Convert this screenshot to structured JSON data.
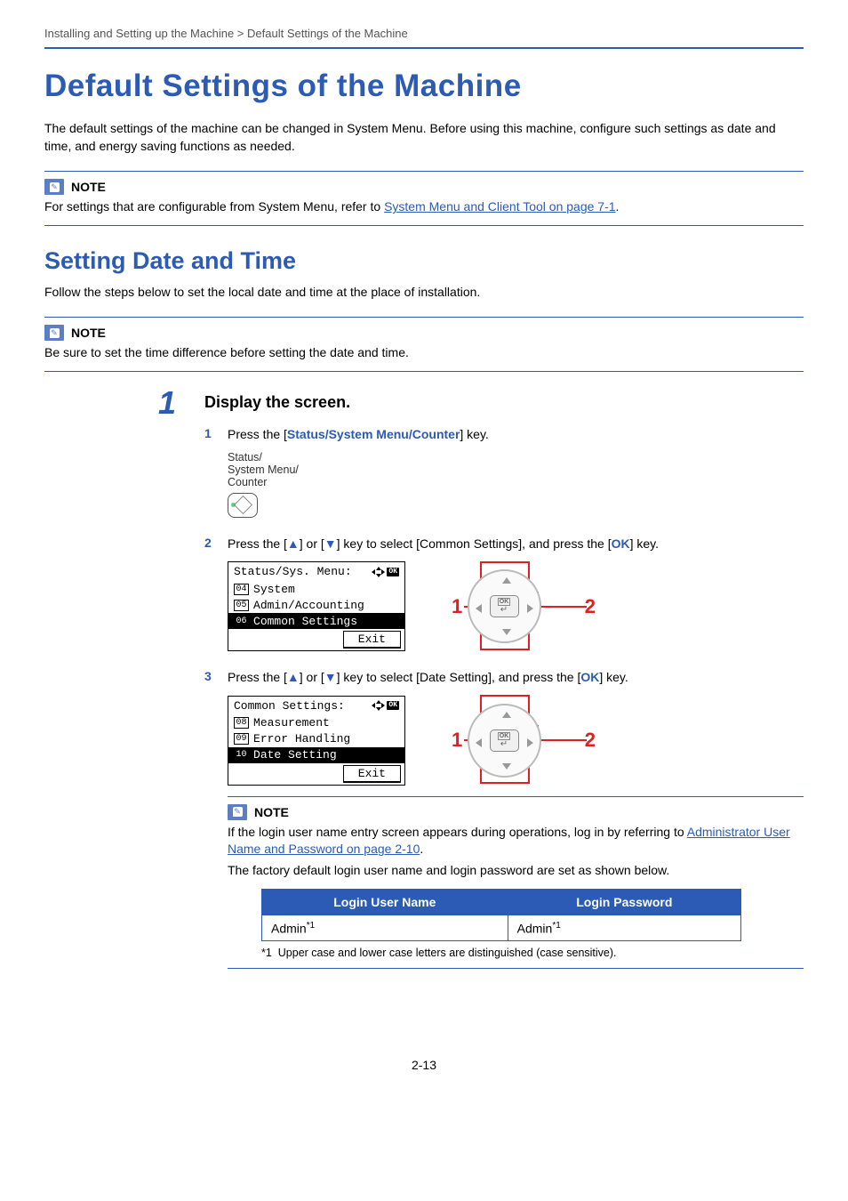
{
  "breadcrumb": "Installing and Setting up the Machine > Default Settings of the Machine",
  "h1": "Default Settings of the Machine",
  "intro": "The default settings of the machine can be changed in System Menu. Before using this machine, configure such settings as date and time, and energy saving functions as needed.",
  "note1": {
    "label": "NOTE",
    "pre": "For settings that are configurable from System Menu, refer to ",
    "link": "System Menu and Client Tool on page 7-1",
    "post": "."
  },
  "h2": "Setting Date and Time",
  "h2_desc": "Follow the steps below to set the local date and time at the place of installation.",
  "note2": {
    "label": "NOTE",
    "text": "Be sure to set the time difference before setting the date and time."
  },
  "step1": {
    "num": "1",
    "title": "Display the screen.",
    "sub1": {
      "num": "1",
      "pre": "Press the [",
      "key": "Status/System Menu/Counter",
      "post": "] key.",
      "phys_label1": "Status/",
      "phys_label2": "System Menu/",
      "phys_label3": "Counter"
    },
    "sub2": {
      "num": "2",
      "text_pre": "Press the [",
      "up": "▲",
      "mid1": "] or [",
      "down": "▼",
      "mid2": "] key to select [Common Settings], and press the [",
      "ok": "OK",
      "text_post": "] key.",
      "lcd": {
        "title": "Status/Sys. Menu:",
        "line1_num": "04",
        "line1": "System",
        "line2_num": "05",
        "line2": "Admin/Accounting",
        "line3_num": "06",
        "line3": "Common Settings",
        "exit": "Exit"
      },
      "callout1": "1",
      "callout2": "2"
    },
    "sub3": {
      "num": "3",
      "text_pre": "Press the [",
      "up": "▲",
      "mid1": "] or [",
      "down": "▼",
      "mid2": "] key to select [Date Setting], and press the [",
      "ok": "OK",
      "text_post": "] key.",
      "lcd": {
        "title": "Common Settings:",
        "line1_num": "08",
        "line1": "Measurement",
        "line2_num": "09",
        "line2": "Error Handling",
        "line3_num": "10",
        "line3": "Date Setting",
        "exit": "Exit"
      },
      "callout1": "1",
      "callout2": "2"
    },
    "inner_note": {
      "label": "NOTE",
      "line1_pre": "If the login user name entry screen appears during operations, log in by referring to ",
      "line1_link": "Administrator User Name and Password on page 2-10",
      "line1_post": ".",
      "line2": "The factory default login user name and login password are set as shown below.",
      "th1": "Login User Name",
      "th2": "Login Password",
      "td1_main": "Admin",
      "td1_ref": "*1",
      "td2_main": "Admin",
      "td2_ref": "*1",
      "footnote_mark": "*1",
      "footnote": "Upper case and lower case letters are distinguished (case sensitive)."
    }
  },
  "page_num": "2-13",
  "ok_glyph": "OK"
}
